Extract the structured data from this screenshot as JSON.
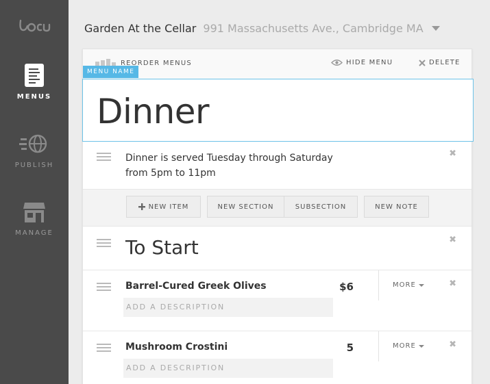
{
  "brand": {
    "logo_text": "locu"
  },
  "sidebar": {
    "items": [
      {
        "label": "MENUS",
        "icon": "document-icon",
        "active": true
      },
      {
        "label": "PUBLISH",
        "icon": "globe-publish-icon",
        "active": false
      },
      {
        "label": "MANAGE",
        "icon": "storefront-icon",
        "active": false
      }
    ]
  },
  "header": {
    "venue_name": "Garden At the Cellar",
    "venue_address": "991 Massachusetts Ave., Cambridge MA"
  },
  "toolbar": {
    "reorder_label": "REORDER MENUS",
    "hide_label": "HIDE MENU",
    "delete_label": "DELETE"
  },
  "menu": {
    "name_tag": "MENU NAME",
    "name": "Dinner",
    "note": "Dinner is served Tuesday through Saturday from 5pm to 11pm"
  },
  "add_buttons": {
    "new_item": "NEW ITEM",
    "new_section": "NEW SECTION",
    "subsection": "SUBSECTION",
    "new_note": "NEW NOTE"
  },
  "section": {
    "title": "To Start"
  },
  "items": [
    {
      "name": "Barrel-Cured Greek Olives",
      "price": "$6",
      "description_placeholder": "ADD A DESCRIPTION",
      "more_label": "MORE"
    },
    {
      "name": "Mushroom Crostini",
      "price": "5",
      "description_placeholder": "ADD A DESCRIPTION",
      "more_label": "MORE"
    }
  ],
  "colors": {
    "sidebar_bg": "#4a4a4a",
    "accent": "#56b8e6",
    "page_bg": "#ececec"
  }
}
